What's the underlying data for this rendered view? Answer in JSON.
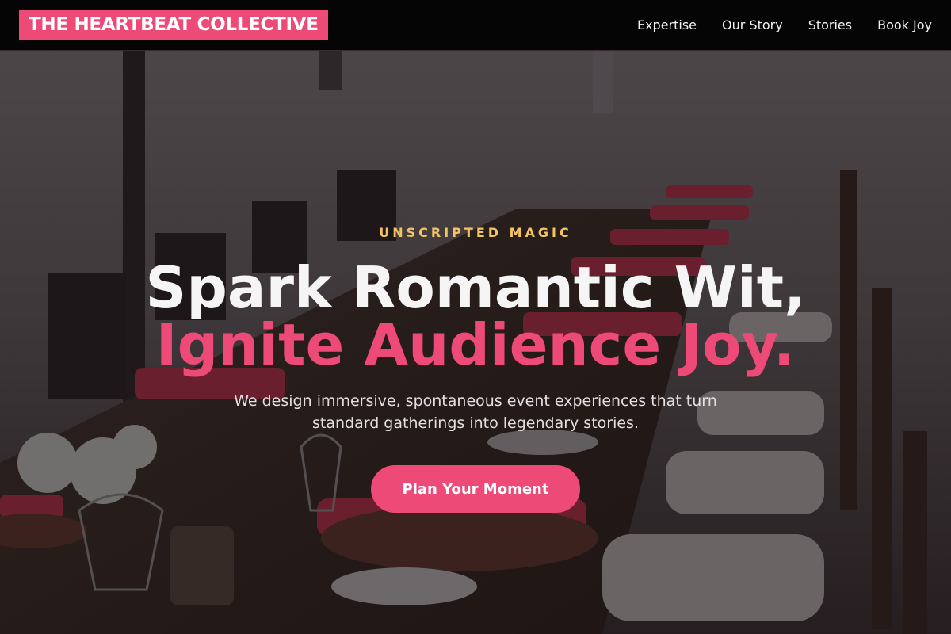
{
  "header": {
    "logo": "THE HEARTBEAT COLLECTIVE",
    "nav": [
      "Expertise",
      "Our Story",
      "Stories",
      "Book Joy"
    ]
  },
  "hero": {
    "eyebrow": "UNSCRIPTED MAGIC",
    "title_line1": "Spark Romantic Wit,",
    "title_line2": "Ignite Audience Joy.",
    "subtitle": "We design immersive, spontaneous event experiences that turn standard gatherings into legendary stories.",
    "cta_label": "Plan Your Moment",
    "background_scene": "long-banquet-table-on-beach-image"
  },
  "colors": {
    "accent": "#ee4a78",
    "eyebrow": "#f4c463",
    "header_bg": "#050505"
  }
}
